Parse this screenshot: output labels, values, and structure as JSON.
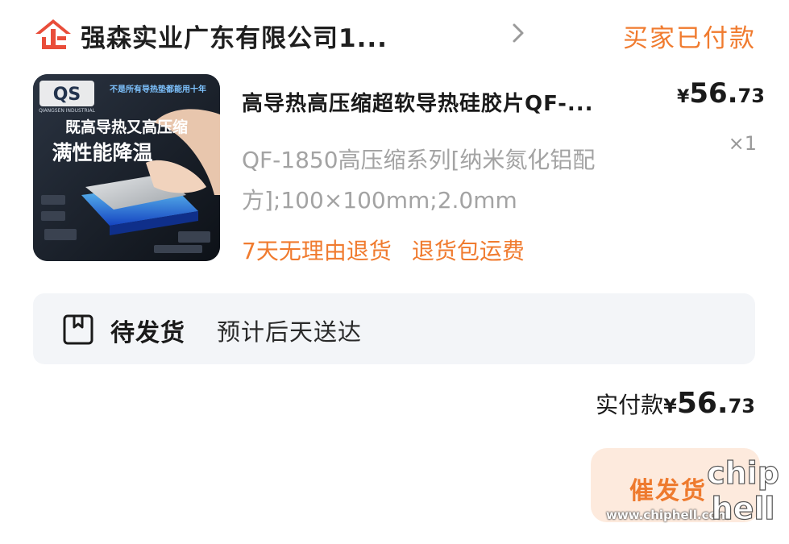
{
  "shop": {
    "logo_icon": "enterprise-badge-icon",
    "name": "强森实业广东有限公司1...",
    "chevron_icon": "chevron-right-icon",
    "accent_color": "#e94d3a"
  },
  "order": {
    "status": "买家已付款",
    "status_color": "#f07b2f"
  },
  "product": {
    "image": {
      "brand": "QS",
      "brand_sub": "QIANGSEN INDUSTRIAL",
      "badge": "不是所有导热垫都能用十年",
      "line1": "既高导热又高压缩",
      "line2": "满性能降温"
    },
    "title": "高导热高压缩超软导热硅胶片QF-...",
    "spec": "QF-1850高压缩系列[纳米氮化铝配方];100×100mm;2.0mm",
    "price": {
      "currency": "¥",
      "integer": "56.",
      "decimal": "73"
    },
    "quantity": "×1",
    "tags": [
      "7天无理由退货",
      "退货包运费"
    ]
  },
  "shipping": {
    "icon": "package-box-icon",
    "status": "待发货",
    "eta": "预计后天送达"
  },
  "payment": {
    "label": "实付款",
    "currency": "¥",
    "integer": "56.",
    "decimal": "73"
  },
  "actions": {
    "urge_label": "催发货",
    "urge_color": "#ee7a2e"
  },
  "watermark": {
    "url": "www.chiphell.com",
    "logo_text": "chiphell"
  }
}
